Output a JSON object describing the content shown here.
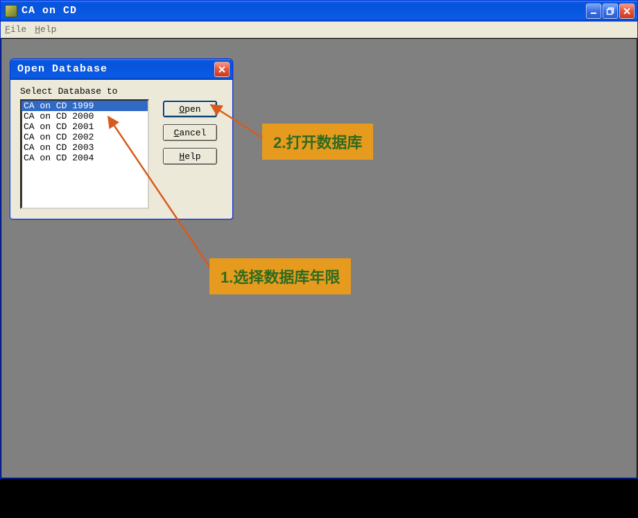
{
  "app": {
    "title": "CA on CD",
    "menu": {
      "file": "File",
      "help": "Help"
    }
  },
  "dialog": {
    "title": "Open Database",
    "label": "Select Database to",
    "items": [
      "CA on CD 1999",
      "CA on CD 2000",
      "CA on CD 2001",
      "CA on CD 2002",
      "CA on CD 2003",
      "CA on CD 2004"
    ],
    "selected_index": 0,
    "buttons": {
      "open": "Open",
      "cancel": "Cancel",
      "help": "Help"
    }
  },
  "annotations": {
    "step1": "1.选择数据库年限",
    "step2": "2.打开数据库"
  },
  "colors": {
    "titlebar_blue": "#0855dd",
    "close_red": "#e8563f",
    "dialog_bg": "#ece9d8",
    "workspace_gray": "#808080",
    "selection_blue": "#316ac5",
    "annotation_bg": "#e69b1e",
    "annotation_text": "#2e6b1f"
  }
}
